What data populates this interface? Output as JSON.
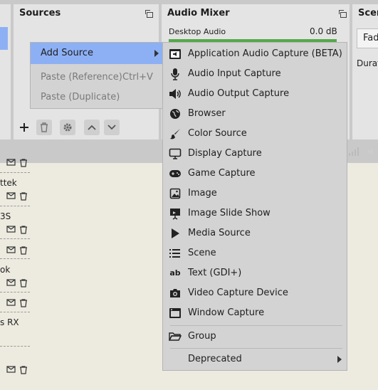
{
  "panels": {
    "sources": {
      "title": "Sources"
    },
    "audio_mixer": {
      "title": "Audio Mixer",
      "channel": {
        "name": "Desktop Audio",
        "level": "0.0 dB"
      }
    },
    "scene_transitions": {
      "title": "Scer",
      "fade": "Fad",
      "duration": "Durat"
    }
  },
  "context_menu": {
    "add_source": "Add Source",
    "paste_reference": "Paste (Reference)",
    "paste_reference_shortcut": "Ctrl+V",
    "paste_duplicate": "Paste (Duplicate)"
  },
  "submenu": {
    "items": [
      {
        "label": "Application Audio Capture (BETA)",
        "icon": "app-audio-icon"
      },
      {
        "label": "Audio Input Capture",
        "icon": "microphone-icon"
      },
      {
        "label": "Audio Output Capture",
        "icon": "speaker-icon"
      },
      {
        "label": "Browser",
        "icon": "globe-icon"
      },
      {
        "label": "Color Source",
        "icon": "paintbrush-icon"
      },
      {
        "label": "Display Capture",
        "icon": "monitor-icon"
      },
      {
        "label": "Game Capture",
        "icon": "gamepad-icon"
      },
      {
        "label": "Image",
        "icon": "image-icon"
      },
      {
        "label": "Image Slide Show",
        "icon": "slideshow-icon"
      },
      {
        "label": "Media Source",
        "icon": "play-icon"
      },
      {
        "label": "Scene",
        "icon": "list-icon"
      },
      {
        "label": "Text (GDI+)",
        "icon": "text-icon"
      },
      {
        "label": "Video Capture Device",
        "icon": "camera-icon"
      },
      {
        "label": "Window Capture",
        "icon": "window-icon"
      }
    ],
    "group": "Group",
    "deprecated": "Deprecated"
  },
  "background_list": {
    "labels": [
      "ttek",
      "3S",
      "ok",
      "s RX"
    ]
  },
  "colors": {
    "highlight": "#8db0f5",
    "menu_bg": "#d3d3d3",
    "panel_bg": "#e4e4e4",
    "page_bg": "#edebe0",
    "meter_green": "#55a84a"
  }
}
